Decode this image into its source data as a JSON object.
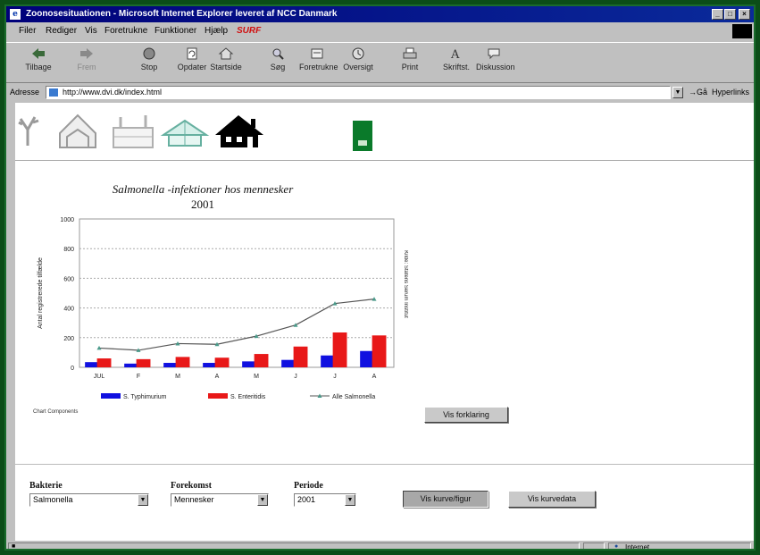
{
  "window": {
    "title": "Zoonosesituationen - Microsoft Internet Explorer leveret af NCC Danmark",
    "min_glyph": "_",
    "max_glyph": "□",
    "close_glyph": "×"
  },
  "menu": {
    "items": [
      "Filer",
      "Rediger",
      "Vis",
      "Foretrukne",
      "Funktioner",
      "Hjælp"
    ],
    "surf": "SURF"
  },
  "toolbar": {
    "buttons": [
      "Tilbage",
      "Frem",
      "Stop",
      "Opdater",
      "Startside",
      "Søg",
      "Foretrukne",
      "Oversigt",
      "Print",
      "Skriftst.",
      "Diskussion"
    ]
  },
  "address": {
    "label": "Adresse",
    "url": "http://www.dvi.dk/index.html",
    "go": "Gå",
    "links": "Hyperlinks"
  },
  "header_icons": [
    "animal-icon",
    "barn-icon",
    "farm-icon",
    "greenhouse-icon",
    "house-icon",
    "logo-icon"
  ],
  "chart_data": {
    "type": "bar",
    "title_line1": "Salmonella -infektioner hos mennesker",
    "title_line2": "2001",
    "categories": [
      "JUL",
      "F",
      "M",
      "A",
      "M",
      "J",
      "J",
      "A"
    ],
    "ylabel": "Antal registrerede tilfælde",
    "right_label": "Kilde: Statens Serum Institut",
    "ylim": [
      0,
      1000
    ],
    "yticks": [
      "0",
      "200",
      "400",
      "600",
      "800",
      "1000"
    ],
    "series": [
      {
        "name": "S. Typhimurium",
        "type": "bar",
        "color": "#1010e0",
        "values": [
          35,
          25,
          30,
          30,
          40,
          50,
          80,
          110
        ]
      },
      {
        "name": "S. Enteritidis",
        "type": "bar",
        "color": "#e81818",
        "values": [
          60,
          55,
          70,
          65,
          90,
          140,
          235,
          215
        ]
      },
      {
        "name": "Alle Salmonella",
        "type": "line",
        "color": "#555555",
        "values": [
          130,
          115,
          160,
          155,
          210,
          285,
          430,
          460
        ]
      }
    ],
    "grid": true,
    "legend": "bottom",
    "source_note": "Chart Components"
  },
  "buttons": {
    "explanation": "Vis forklaring",
    "show_curve": "Vis kurve/figur",
    "show_data": "Vis kurvedata"
  },
  "form": {
    "bacteria": {
      "label": "Bakterie",
      "value": "Salmonella"
    },
    "occurrence": {
      "label": "Forekomst",
      "value": "Mennesker"
    },
    "period": {
      "label": "Periode",
      "value": "2001"
    }
  },
  "status": {
    "zone": "Internet"
  }
}
